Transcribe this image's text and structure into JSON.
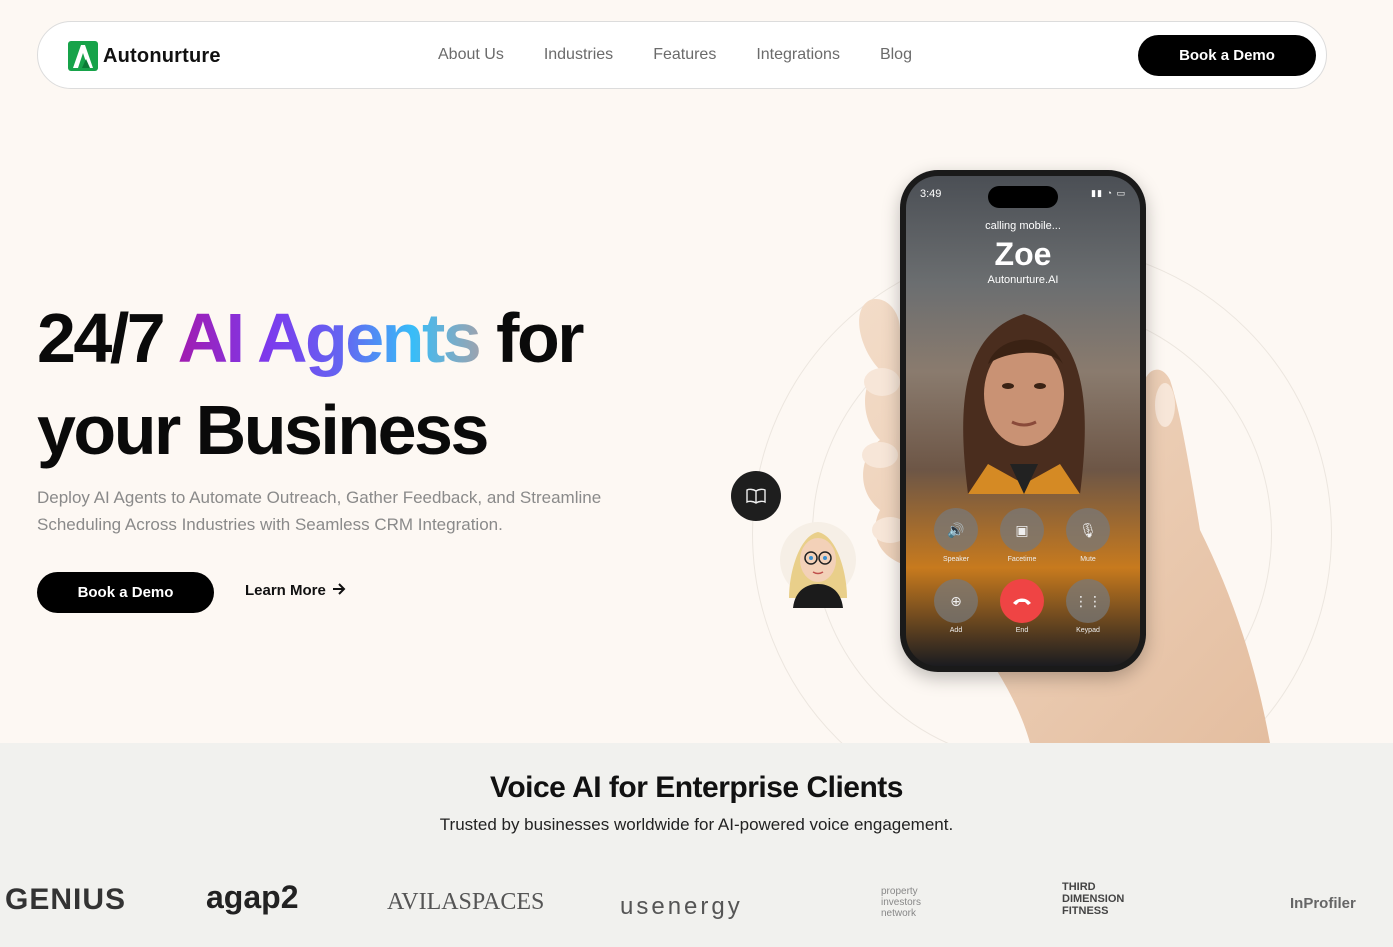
{
  "nav": {
    "brand": "Autonurture",
    "links": [
      "About Us",
      "Industries",
      "Features",
      "Integrations",
      "Blog"
    ],
    "cta": "Book a Demo"
  },
  "hero": {
    "title_part1": "24/7 ",
    "title_highlight": "AI Agents",
    "title_part2": " for",
    "title_line2": "your Business",
    "subtitle": "Deploy AI Agents to Automate Outreach, Gather Feedback, and Streamline Scheduling Across Industries with Seamless CRM Integration.",
    "cta": "Book a Demo",
    "learn_more": "Learn More"
  },
  "phone": {
    "time": "3:49",
    "status": "calling mobile...",
    "caller": "Zoe",
    "company": "Autonurture.AI",
    "buttons": [
      "Speaker",
      "Facetime",
      "Mute",
      "Add",
      "End",
      "Keypad"
    ]
  },
  "clients": {
    "title": "Voice AI for Enterprise Clients",
    "subtitle": "Trusted by businesses worldwide for AI-powered voice engagement.",
    "logos": [
      "GENIUS",
      "agap2",
      "AVILASPACES",
      "usenergy",
      "property investors network",
      "THIRD DIMENSION FITNESS",
      "InProfiler"
    ]
  },
  "colors": {
    "brand": "#17a34a",
    "primary": "#000000",
    "background": "#fdf8f3",
    "end_call": "#ef4444"
  }
}
